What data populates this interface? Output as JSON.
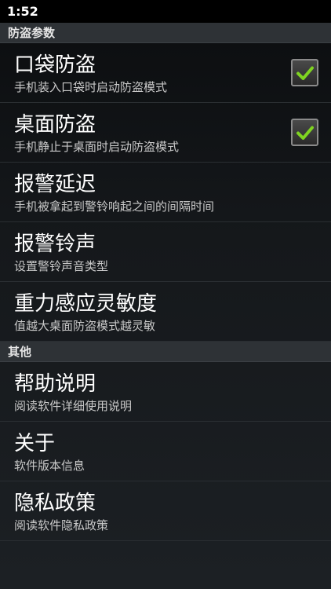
{
  "status_bar": {
    "time": "1:52"
  },
  "sections": [
    {
      "header": "防盗参数",
      "items": [
        {
          "title": "口袋防盗",
          "summary": "手机装入口袋时启动防盗模式",
          "checked": true
        },
        {
          "title": "桌面防盗",
          "summary": "手机静止于桌面时启动防盗模式",
          "checked": true
        },
        {
          "title": "报警延迟",
          "summary": "手机被拿起到警铃响起之间的间隔时间"
        },
        {
          "title": "报警铃声",
          "summary": "设置警铃声音类型"
        },
        {
          "title": "重力感应灵敏度",
          "summary": "值越大桌面防盗模式越灵敏"
        }
      ]
    },
    {
      "header": "其他",
      "items": [
        {
          "title": "帮助说明",
          "summary": "阅读软件详细使用说明"
        },
        {
          "title": "关于",
          "summary": "软件版本信息"
        },
        {
          "title": "隐私政策",
          "summary": "阅读软件隐私政策"
        }
      ]
    }
  ],
  "colors": {
    "check_mark": "#7fd321",
    "background": "#15181b",
    "section_header_bg": "#2e3236"
  },
  "icons": {
    "checkbox_checked": "check-icon"
  }
}
